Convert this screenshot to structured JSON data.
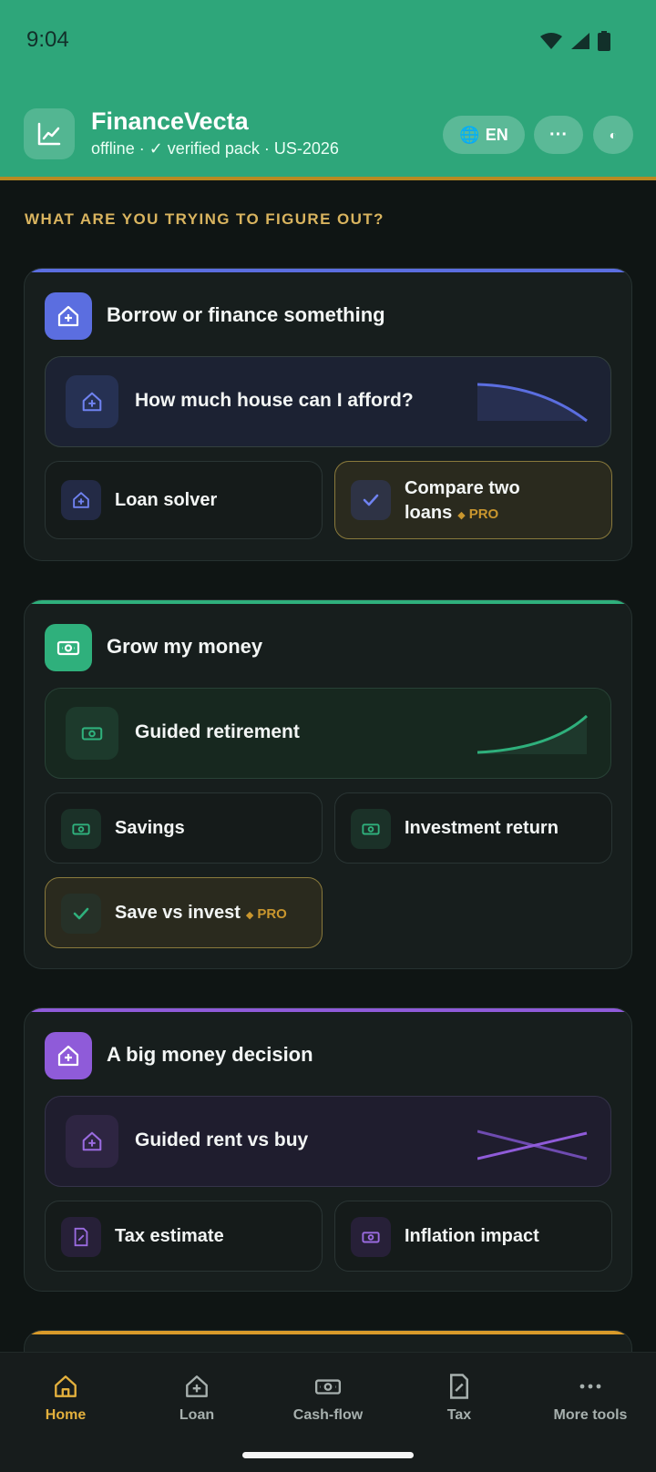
{
  "status": {
    "time": "9:04"
  },
  "app": {
    "title": "FinanceVecta",
    "subtitle": "offline · ✓ verified pack · US-2026",
    "lang_label": "EN",
    "more_label": "···",
    "theme_label": "◐"
  },
  "section_label": "WHAT ARE YOU TRYING TO FIGURE OUT?",
  "groups": [
    {
      "title": "Borrow or finance something",
      "accent": "#5b6ee0",
      "hero": "How much house can I afford?",
      "tiles": [
        {
          "label": "Loan solver",
          "pro": false
        },
        {
          "label": "Compare two loans",
          "pro": true,
          "pro_label": "PRO"
        }
      ]
    },
    {
      "title": "Grow my money",
      "accent": "#2fb07c",
      "hero": "Guided retirement",
      "tiles": [
        {
          "label": "Savings",
          "pro": false
        },
        {
          "label": "Investment return",
          "pro": false
        },
        {
          "label": "Save vs invest",
          "pro": true,
          "pro_label": "PRO"
        }
      ]
    },
    {
      "title": "A big money decision",
      "accent": "#8f5bd9",
      "hero": "Guided rent vs buy",
      "tiles": [
        {
          "label": "Tax estimate",
          "pro": false
        },
        {
          "label": "Inflation impact",
          "pro": false
        }
      ]
    }
  ],
  "nav": [
    {
      "label": "Home",
      "icon": "home-icon",
      "active": true
    },
    {
      "label": "Loan",
      "icon": "loan-icon",
      "active": false
    },
    {
      "label": "Cash-flow",
      "icon": "cash-icon",
      "active": false
    },
    {
      "label": "Tax",
      "icon": "tax-icon",
      "active": false
    },
    {
      "label": "More tools",
      "icon": "more-icon",
      "active": false
    }
  ],
  "colors": {
    "header": "#2ea67a",
    "gold": "#d9b45f",
    "nav_active": "#e3b03d"
  }
}
